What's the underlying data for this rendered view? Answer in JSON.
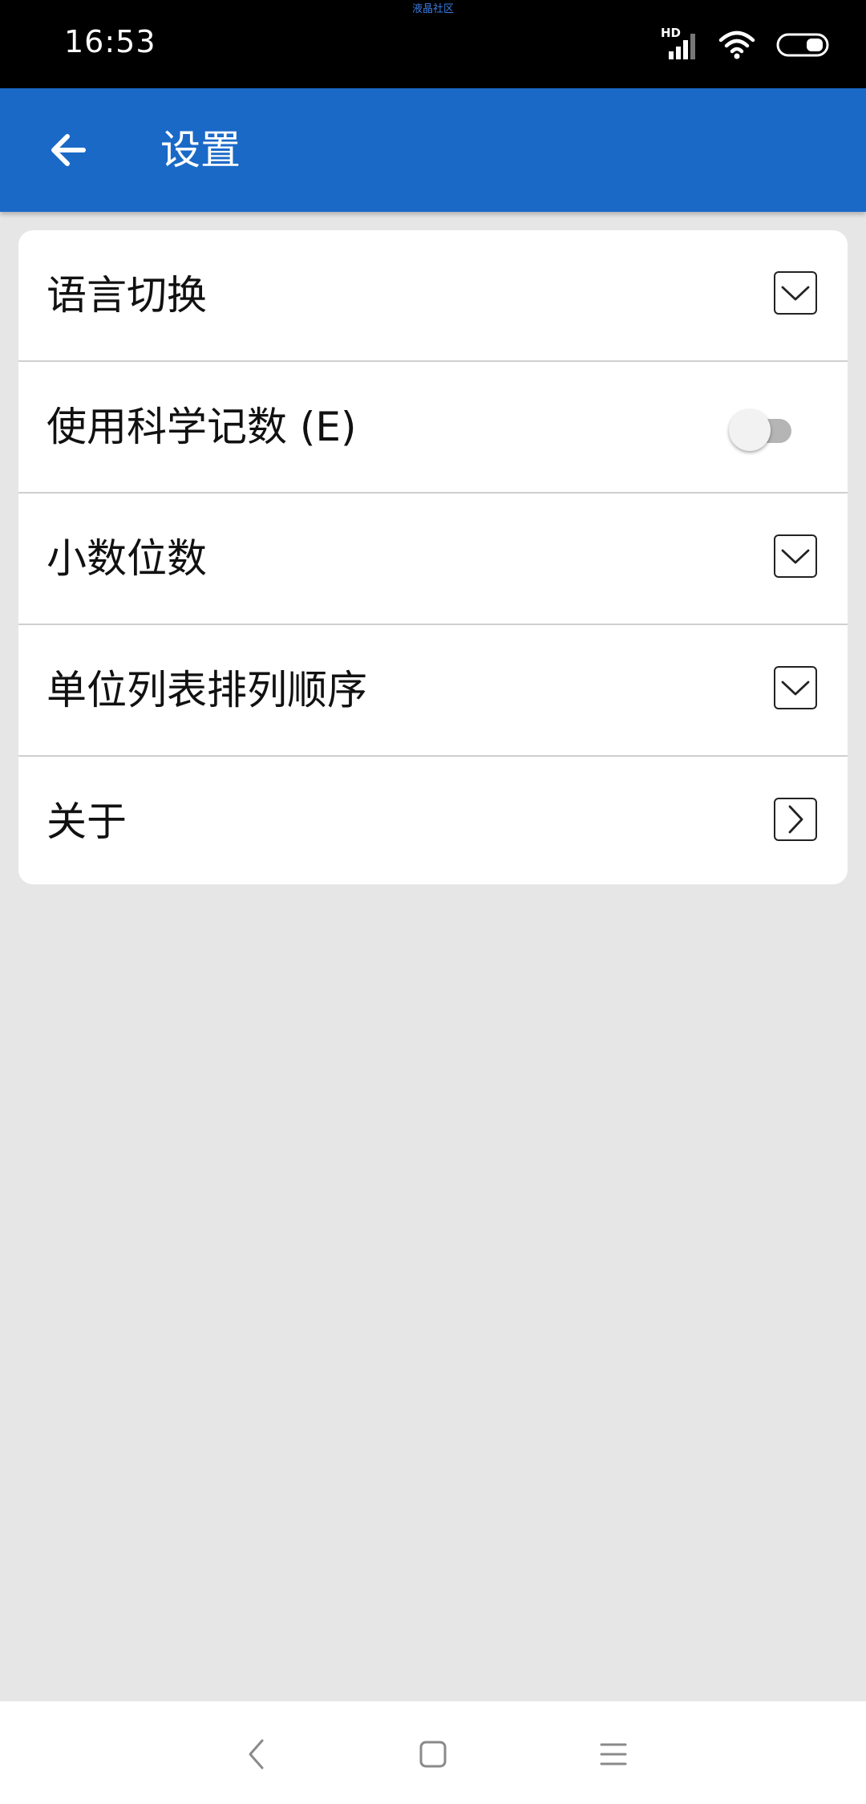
{
  "status_bar": {
    "time": "16:53",
    "watermark": "液晶社区",
    "network_label": "HD",
    "icons": [
      "signal-icon",
      "wifi-icon",
      "battery-icon"
    ]
  },
  "app_bar": {
    "title": "设置",
    "back_icon": "arrow-left-icon",
    "background_color": "#1a69c7"
  },
  "settings": {
    "items": [
      {
        "label": "语言切换",
        "control": "dropdown"
      },
      {
        "label": "使用科学记数 (E)",
        "control": "toggle",
        "enabled": false
      },
      {
        "label": "小数位数",
        "control": "dropdown"
      },
      {
        "label": "单位列表排列顺序",
        "control": "dropdown"
      },
      {
        "label": "关于",
        "control": "chevron-right"
      }
    ]
  },
  "nav_bar": {
    "buttons": [
      "back-nav-icon",
      "home-nav-icon",
      "menu-nav-icon"
    ]
  }
}
